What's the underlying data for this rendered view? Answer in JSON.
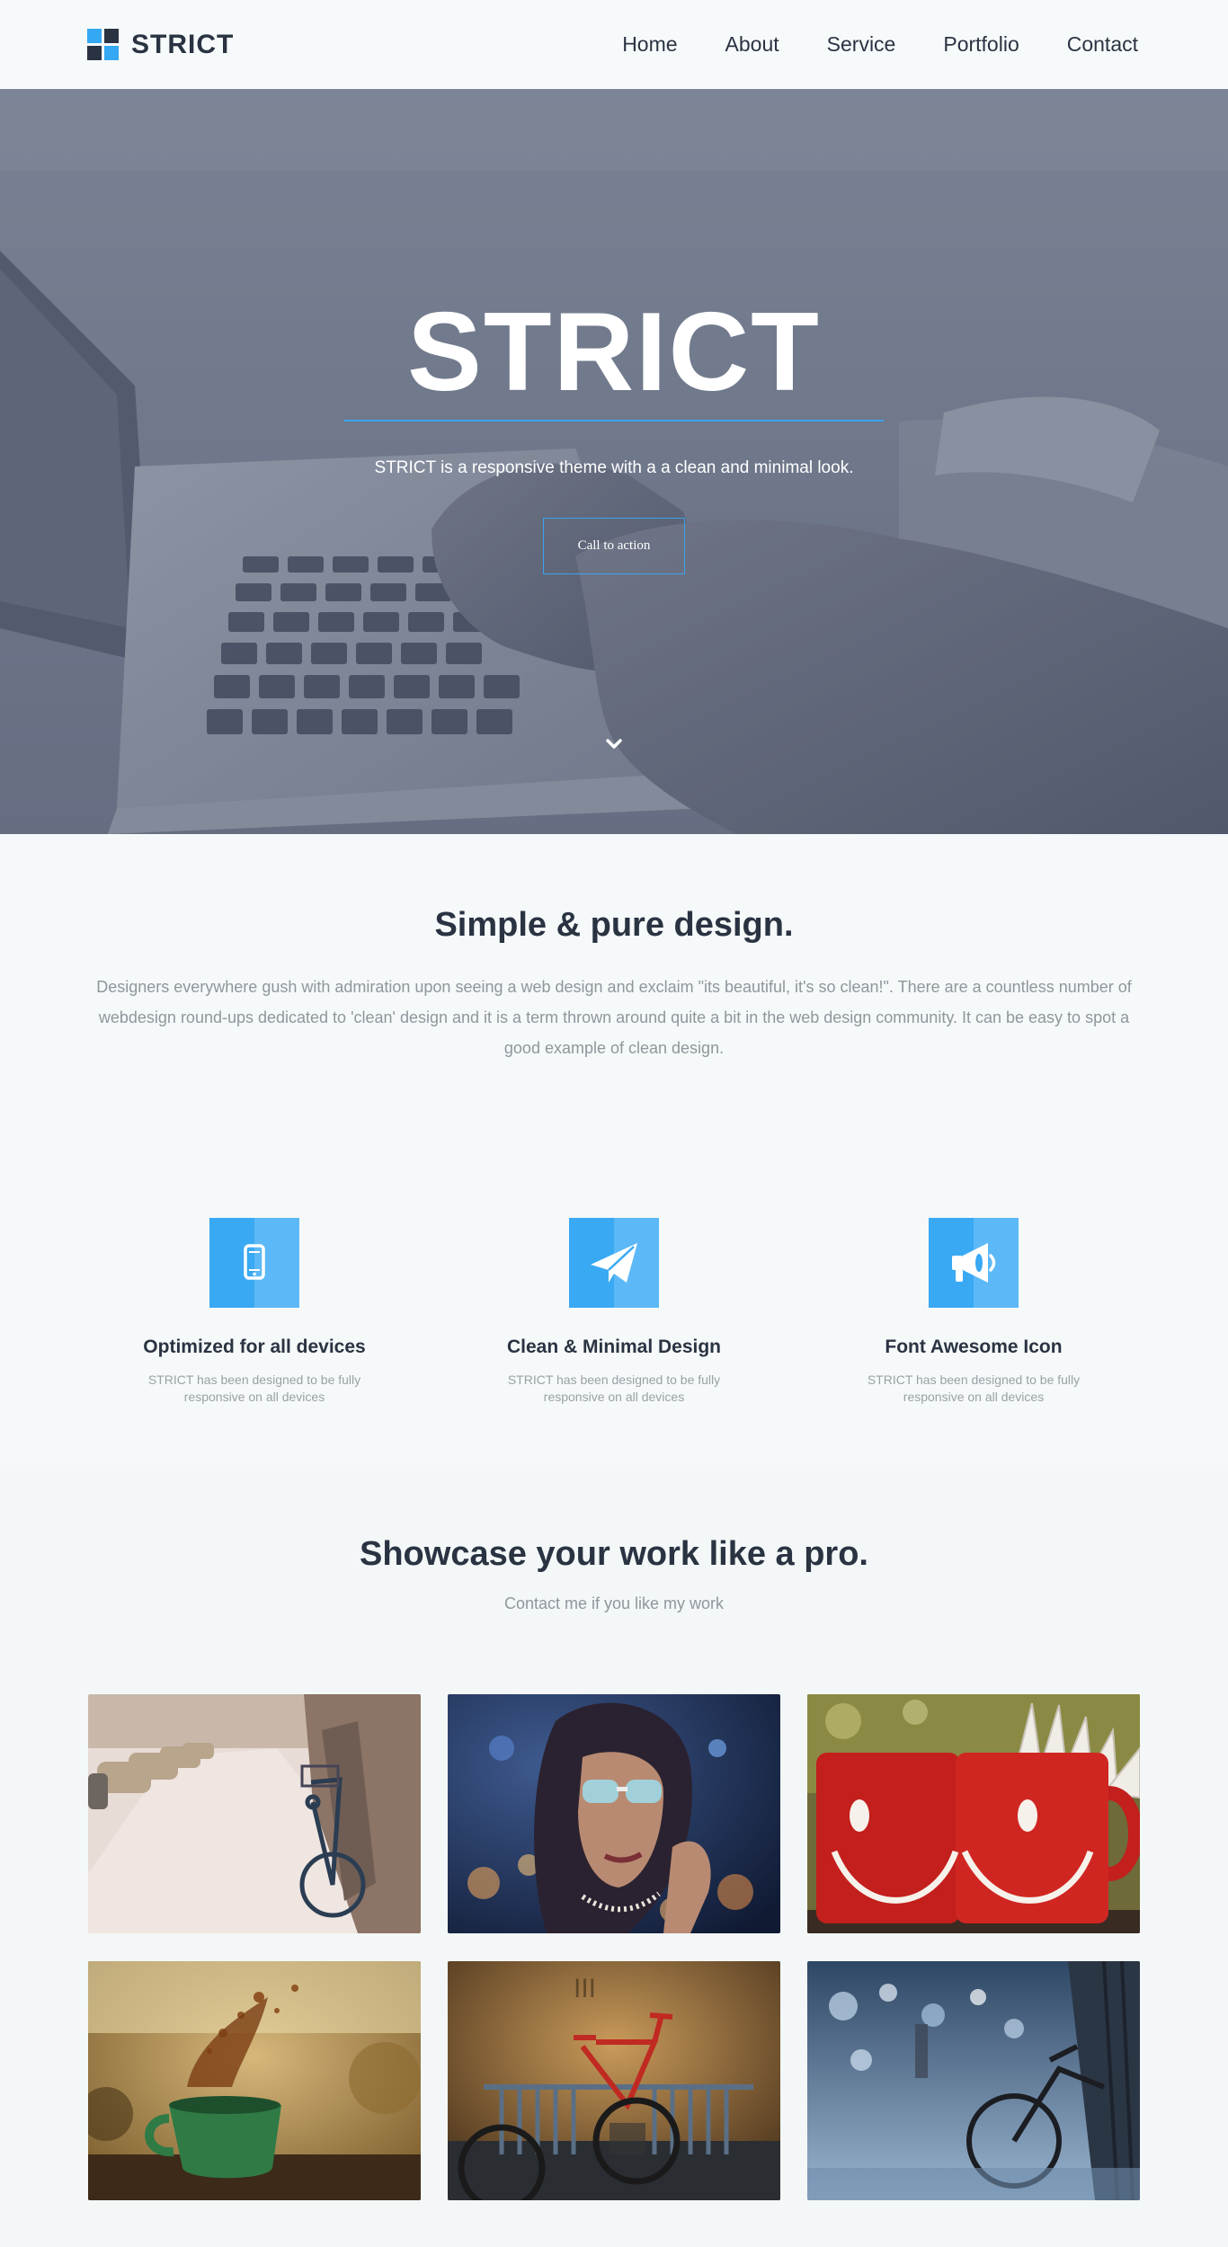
{
  "header": {
    "brand": "STRICT",
    "nav": [
      "Home",
      "About",
      "Service",
      "Portfolio",
      "Contact"
    ]
  },
  "hero": {
    "title": "STRICT",
    "subtitle": "STRICT is a responsive theme with a a clean and minimal look.",
    "cta_label": "Call to action",
    "scroll_icon": "chevron-down-icon"
  },
  "intro": {
    "title": "Simple & pure design.",
    "text": "Designers everywhere gush with admiration upon seeing a web design and exclaim \"its beautiful, it's so clean!\". There are a countless number of webdesign round-ups dedicated to 'clean' design and it is a term thrown around quite a bit in the web design community. It can be easy to spot a good example of clean design."
  },
  "features": [
    {
      "icon": "mobile-icon",
      "title": "Optimized for all devices",
      "text": "STRICT has been designed to be fully responsive on all devices"
    },
    {
      "icon": "paper-plane-icon",
      "title": "Clean & Minimal Design",
      "text": "STRICT has been designed to be fully responsive on all devices"
    },
    {
      "icon": "bullhorn-icon",
      "title": "Font Awesome Icon",
      "text": "STRICT has been designed to be fully responsive on all devices"
    }
  ],
  "showcase": {
    "title": "Showcase your work like a pro.",
    "subtitle": "Contact me if you like my work",
    "items": [
      "bicycle-street-photo",
      "woman-sunglasses-photo",
      "red-smiley-mugs-photo",
      "green-cup-splash-photo",
      "red-bicycle-rack-photo",
      "bicycle-bokeh-photo"
    ]
  },
  "colors": {
    "accent": "#35a8f3",
    "dark": "#2a3342",
    "muted": "#8f969d",
    "background": "#f6f9f9"
  }
}
